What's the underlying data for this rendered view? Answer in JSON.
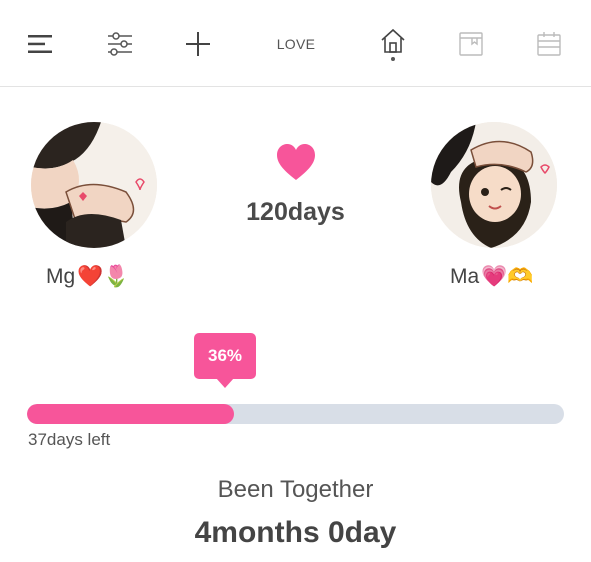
{
  "toolbar": {
    "love_label": "LOVE",
    "icons": [
      "menu-icon",
      "sliders-icon",
      "add-icon",
      "home-icon",
      "book-icon",
      "calendar-icon"
    ]
  },
  "couple": {
    "left": {
      "name": "Mg",
      "emojis": "❤️🌷"
    },
    "right": {
      "name": "Ma",
      "emojis": "💗🫶"
    }
  },
  "counter": {
    "days": "120days"
  },
  "progress": {
    "percent_label": "36%",
    "fraction": 0.385,
    "days_left": "37days left"
  },
  "together": {
    "label": "Been Together",
    "value": "4months 0day"
  },
  "colors": {
    "accent": "#f7559a",
    "track": "#d8dee7"
  }
}
